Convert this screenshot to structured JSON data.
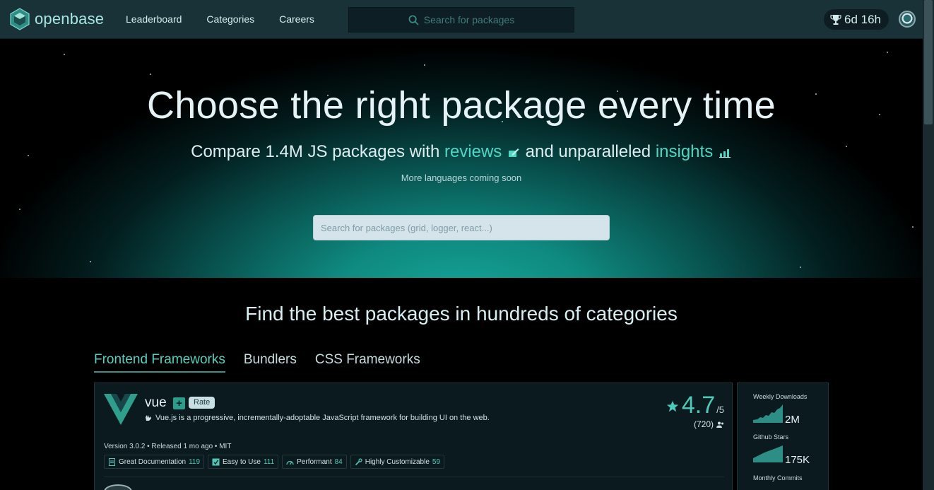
{
  "header": {
    "logo_text": "openbase",
    "nav": [
      "Leaderboard",
      "Categories",
      "Careers"
    ],
    "search_placeholder": "Search for packages",
    "timer": "6d 16h",
    "icons": {
      "search": "search-icon",
      "trophy": "trophy-icon",
      "avatar": "avatar"
    }
  },
  "hero": {
    "title": "Choose the right package every time",
    "sub_prefix": "Compare 1.4M JS packages with ",
    "sub_reviews": "reviews",
    "sub_middle": " and unparalleled ",
    "sub_insights": "insights",
    "note": "More languages coming soon",
    "search_placeholder": "Search for packages (grid, logger, react...)"
  },
  "categories": {
    "title": "Find the best packages in hundreds of categories",
    "tabs": [
      "Frontend Frameworks",
      "Bundlers",
      "CSS Frameworks"
    ],
    "active_tab": 0
  },
  "package": {
    "name": "vue",
    "plus": "+",
    "rate": "Rate",
    "description": "Vue.js is a progressive, incrementally-adoptable JavaScript framework for building UI on the web.",
    "rating": "4.7",
    "rating_max": "/5",
    "rating_count": "(720)",
    "version_line": "Version 3.0.2 • Released 1 mo ago • MIT",
    "badges": [
      {
        "label": "Great Documentation",
        "count": "119"
      },
      {
        "label": "Easy to Use",
        "count": "111"
      },
      {
        "label": "Performant",
        "count": "84"
      },
      {
        "label": "Highly Customizable",
        "count": "59"
      }
    ]
  },
  "stats": {
    "weekly_downloads_label": "Weekly Downloads",
    "weekly_downloads": "2M",
    "github_stars_label": "Github Stars",
    "github_stars": "175K",
    "monthly_commits_label": "Monthly Commits"
  },
  "colors": {
    "accent": "#4ec9b7",
    "header_bg": "#183238",
    "hero_glow": "#17a89a"
  }
}
